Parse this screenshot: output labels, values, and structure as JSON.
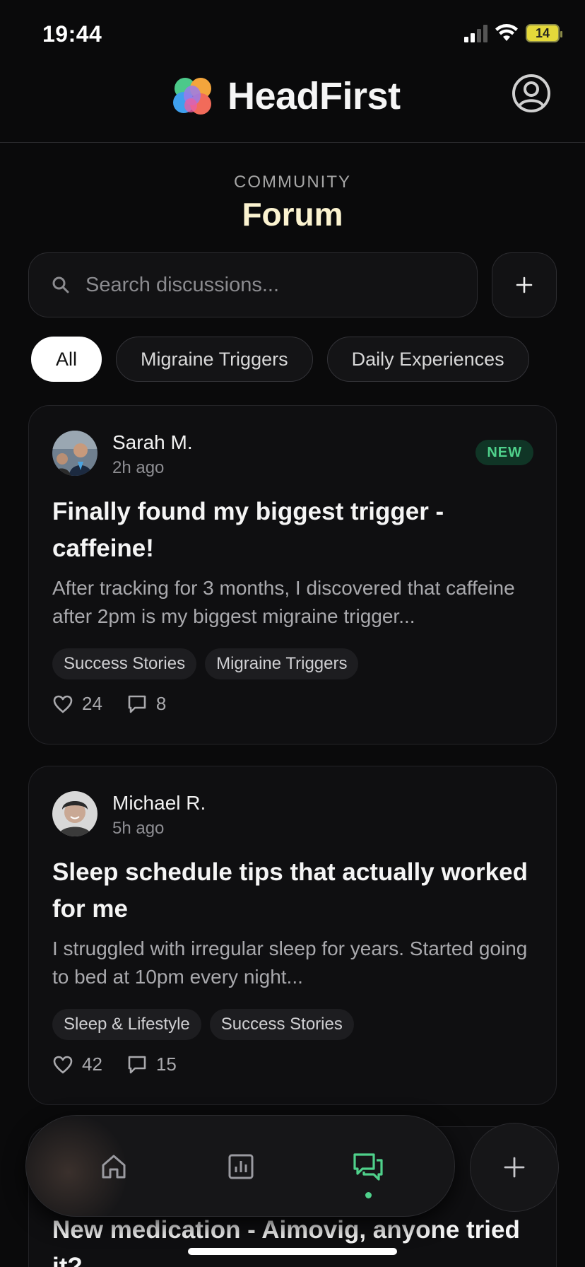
{
  "status_bar": {
    "time": "19:44",
    "battery": "14"
  },
  "header": {
    "app_name": "HeadFirst",
    "profile_icon": "user-circle-icon"
  },
  "page": {
    "section_label": "COMMUNITY",
    "title": "Forum"
  },
  "search": {
    "placeholder": "Search discussions...",
    "value": ""
  },
  "filters": [
    {
      "label": "All",
      "active": true
    },
    {
      "label": "Migraine Triggers",
      "active": false
    },
    {
      "label": "Daily Experiences",
      "active": false
    }
  ],
  "posts": [
    {
      "author": "Sarah M.",
      "time": "2h ago",
      "badge": "NEW",
      "title": "Finally found my biggest trigger - caffeine!",
      "excerpt": "After tracking for 3 months, I discovered that caffeine after 2pm is my biggest migraine trigger...",
      "tags": [
        "Success Stories",
        "Migraine Triggers"
      ],
      "likes": "24",
      "comments": "8"
    },
    {
      "author": "Michael R.",
      "time": "5h ago",
      "title": "Sleep schedule tips that actually worked for me",
      "excerpt": "I struggled with irregular sleep for years. Started going to bed at 10pm every night...",
      "tags": [
        "Sleep & Lifestyle",
        "Success Stories"
      ],
      "likes": "42",
      "comments": "15"
    },
    {
      "title": "New medication - Aimovig, anyone tried it?"
    }
  ],
  "nav": {
    "items": [
      "home-icon",
      "stats-icon",
      "forum-icon"
    ],
    "active": "forum-icon",
    "accent": "#4fd18b"
  },
  "colors": {
    "background": "#0a0a0b",
    "title": "#fbf3d0",
    "accent": "#4fd18b"
  }
}
